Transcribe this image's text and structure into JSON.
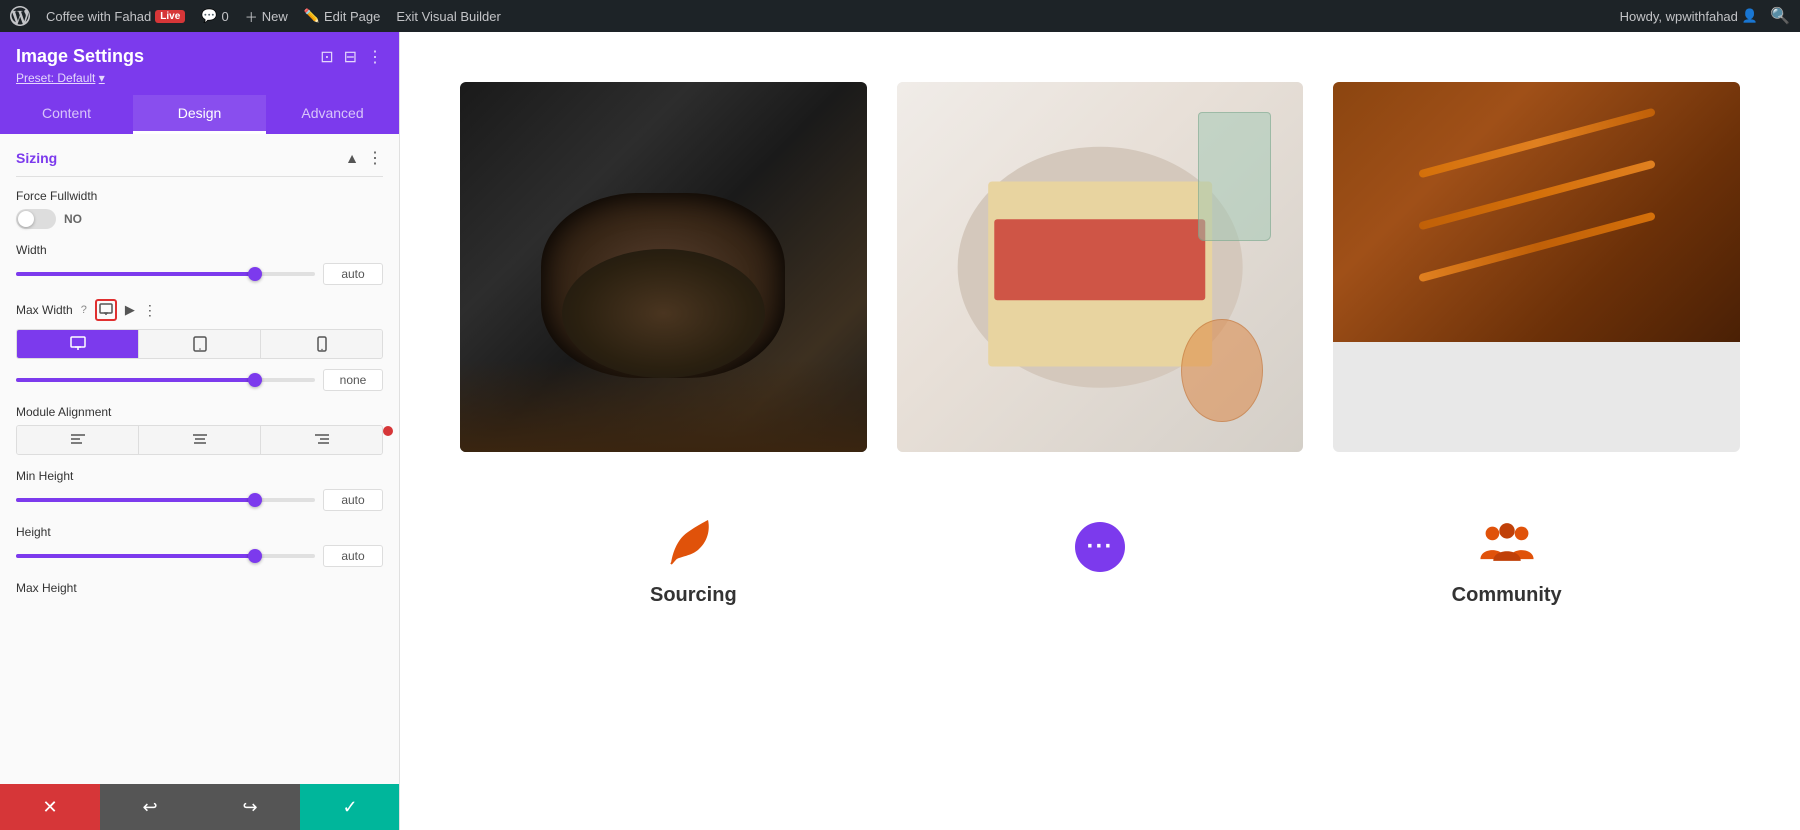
{
  "admin_bar": {
    "site_name": "Coffee with Fahad",
    "live_badge": "Live",
    "comments_count": "0",
    "new_label": "New",
    "edit_page_label": "Edit Page",
    "exit_label": "Exit Visual Builder",
    "howdy": "Howdy, wpwithfahad"
  },
  "panel": {
    "title": "Image Settings",
    "preset_label": "Preset: Default",
    "tabs": [
      "Content",
      "Design",
      "Advanced"
    ],
    "active_tab": "Design",
    "sections": {
      "sizing": {
        "title": "Sizing",
        "fields": {
          "force_fullwidth": "Force Fullwidth",
          "force_fullwidth_value": "NO",
          "width": "Width",
          "width_value": "auto",
          "max_width": "Max Width",
          "max_width_value": "none",
          "module_alignment": "Module Alignment",
          "min_height": "Min Height",
          "min_height_value": "auto",
          "height": "Height",
          "height_value": "auto",
          "max_height": "Max Height"
        }
      }
    }
  },
  "bottom_bar": {
    "cancel_icon": "✕",
    "undo_icon": "↩",
    "redo_icon": "↪",
    "save_icon": "✓"
  },
  "content": {
    "images": [
      {
        "type": "coffee",
        "alt": "Coffee beans in grinder"
      },
      {
        "type": "food",
        "alt": "Toast with jam"
      },
      {
        "type": "bbq",
        "alt": "BBQ skewers"
      }
    ],
    "icons": [
      {
        "name": "sourcing",
        "label": "Sourcing",
        "color": "#e0520a"
      },
      {
        "name": "floating-button",
        "label": "",
        "color": "#7c3aed"
      },
      {
        "name": "community",
        "label": "Community",
        "color": "#e0520a"
      }
    ]
  },
  "device_buttons": [
    "desktop",
    "tablet",
    "mobile"
  ],
  "alignment_buttons": [
    "left",
    "center",
    "right"
  ]
}
